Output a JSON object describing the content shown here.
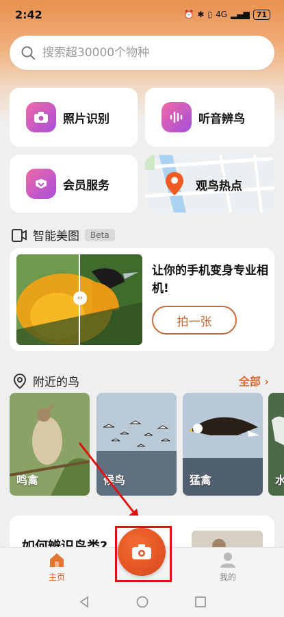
{
  "status_bar": {
    "time": "2:42",
    "network": "4G",
    "battery": "71"
  },
  "search": {
    "placeholder": "搜索超30000个物种"
  },
  "features": {
    "photo_id": "照片识别",
    "sound_id": "听音辨鸟",
    "membership": "会员服务",
    "hotspots": "观鸟热点"
  },
  "smart_photo": {
    "title": "智能美图",
    "badge": "Beta",
    "tagline": "让你的手机变身专业相机!",
    "button": "拍一张"
  },
  "nearby": {
    "title": "附近的鸟",
    "see_all": "全部 ›",
    "categories": [
      "鸣禽",
      "候鸟",
      "猛禽",
      "水"
    ]
  },
  "info_card": {
    "title": "如何辨识鸟类?"
  },
  "bottom_nav": {
    "home": "主页",
    "mine": "我的"
  },
  "colors": {
    "accent": "#d9642a",
    "highlight": "#e01010"
  }
}
